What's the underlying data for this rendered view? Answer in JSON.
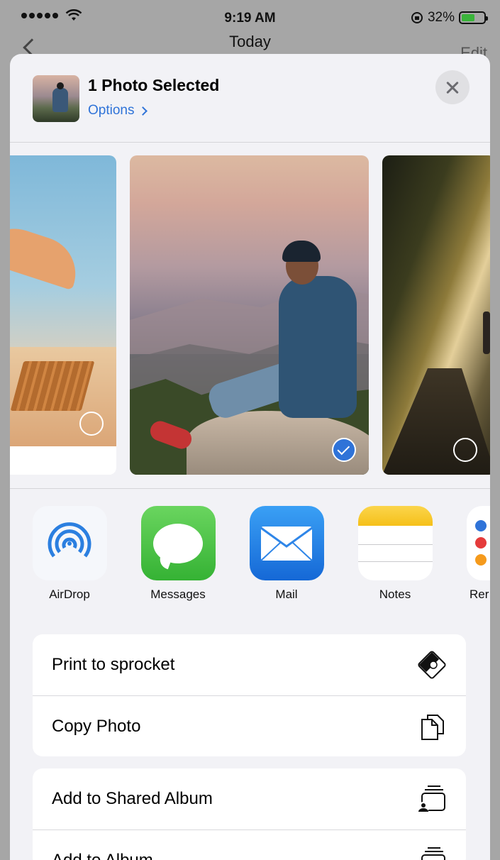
{
  "status_bar": {
    "time": "9:19 AM",
    "battery_percent": "32%",
    "battery_level": 0.32
  },
  "background_app": {
    "title": "Today",
    "right_button": "Edit"
  },
  "share_sheet": {
    "header": {
      "title": "1 Photo Selected",
      "options_label": "Options"
    },
    "photos": [
      {
        "name": "beach",
        "selected": false
      },
      {
        "name": "man-on-rock",
        "selected": true
      },
      {
        "name": "forest-path",
        "selected": false
      }
    ],
    "apps": [
      {
        "label": "AirDrop",
        "icon": "airdrop-icon"
      },
      {
        "label": "Messages",
        "icon": "messages-icon"
      },
      {
        "label": "Mail",
        "icon": "mail-icon"
      },
      {
        "label": "Notes",
        "icon": "notes-icon"
      },
      {
        "label": "Rer",
        "icon": "reminders-icon"
      }
    ],
    "actions_group_1": [
      {
        "label": "Print to sprocket",
        "icon": "sprocket-icon"
      },
      {
        "label": "Copy Photo",
        "icon": "copy-icon"
      }
    ],
    "actions_group_2": [
      {
        "label": "Add to Shared Album",
        "icon": "shared-album-icon"
      },
      {
        "label": "Add to Album",
        "icon": "album-icon"
      }
    ]
  }
}
